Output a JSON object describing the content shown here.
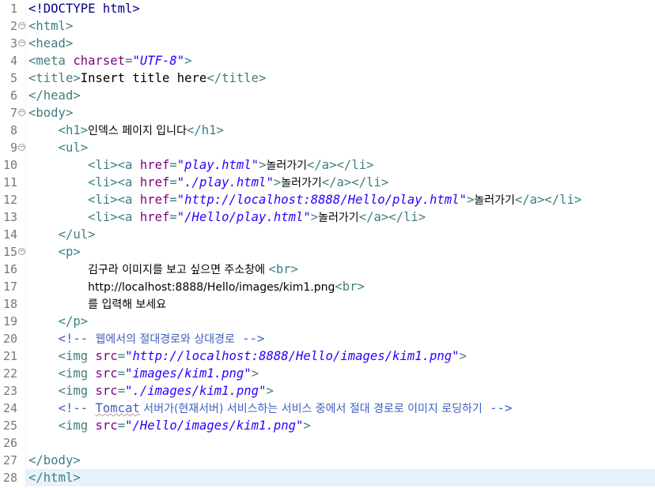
{
  "editor": {
    "current_line": 28,
    "colors": {
      "tag": "#3f7f7f",
      "attribute": "#7f007f",
      "value": "#2a00ff",
      "comment": "#3f5fbf",
      "doctype": "#000080",
      "text": "#000000",
      "current_line_bg": "#e8f2fe",
      "line_number": "#787878"
    },
    "lines": [
      {
        "no": "1",
        "fold": false,
        "tokens": [
          {
            "t": "dt",
            "v": "<!DOCTYPE html>"
          }
        ]
      },
      {
        "no": "2",
        "fold": true,
        "tokens": [
          {
            "t": "tag",
            "v": "<html>"
          }
        ]
      },
      {
        "no": "3",
        "fold": true,
        "tokens": [
          {
            "t": "tag",
            "v": "<head>"
          }
        ]
      },
      {
        "no": "4",
        "fold": false,
        "tokens": [
          {
            "t": "tag",
            "v": "<meta "
          },
          {
            "t": "attr",
            "v": "charset"
          },
          {
            "t": "tag",
            "v": "="
          },
          {
            "t": "val",
            "v": "\"UTF-8\""
          },
          {
            "t": "tag",
            "v": ">"
          }
        ]
      },
      {
        "no": "5",
        "fold": false,
        "tokens": [
          {
            "t": "tag",
            "v": "<title>"
          },
          {
            "t": "text",
            "v": "Insert title here"
          },
          {
            "t": "tag",
            "v": "</title>"
          }
        ]
      },
      {
        "no": "6",
        "fold": false,
        "tokens": [
          {
            "t": "tag",
            "v": "</head>"
          }
        ]
      },
      {
        "no": "7",
        "fold": true,
        "tokens": [
          {
            "t": "tag",
            "v": "<body>"
          }
        ]
      },
      {
        "no": "8",
        "fold": false,
        "tokens": [
          {
            "t": "sp",
            "v": "    "
          },
          {
            "t": "tag",
            "v": "<h1>"
          },
          {
            "t": "ko",
            "v": "인덱스 페이지 입니다"
          },
          {
            "t": "tag",
            "v": "</h1>"
          }
        ]
      },
      {
        "no": "9",
        "fold": true,
        "tokens": [
          {
            "t": "sp",
            "v": "    "
          },
          {
            "t": "tag",
            "v": "<ul>"
          }
        ]
      },
      {
        "no": "10",
        "fold": false,
        "tokens": [
          {
            "t": "sp",
            "v": "        "
          },
          {
            "t": "tag",
            "v": "<li><a "
          },
          {
            "t": "attr",
            "v": "href"
          },
          {
            "t": "tag",
            "v": "="
          },
          {
            "t": "val",
            "v": "\"play.html\""
          },
          {
            "t": "tag",
            "v": ">"
          },
          {
            "t": "ko",
            "v": "놀러가기"
          },
          {
            "t": "tag",
            "v": "</a></li>"
          }
        ]
      },
      {
        "no": "11",
        "fold": false,
        "tokens": [
          {
            "t": "sp",
            "v": "        "
          },
          {
            "t": "tag",
            "v": "<li><a "
          },
          {
            "t": "attr",
            "v": "href"
          },
          {
            "t": "tag",
            "v": "="
          },
          {
            "t": "val",
            "v": "\"./play.html\""
          },
          {
            "t": "tag",
            "v": ">"
          },
          {
            "t": "ko",
            "v": "놀러가기"
          },
          {
            "t": "tag",
            "v": "</a></li>"
          }
        ]
      },
      {
        "no": "12",
        "fold": false,
        "tokens": [
          {
            "t": "sp",
            "v": "        "
          },
          {
            "t": "tag",
            "v": "<li><a "
          },
          {
            "t": "attr",
            "v": "href"
          },
          {
            "t": "tag",
            "v": "="
          },
          {
            "t": "val",
            "v": "\"http://localhost:8888/Hello/play.html\""
          },
          {
            "t": "tag",
            "v": ">"
          },
          {
            "t": "ko",
            "v": "놀러가기"
          },
          {
            "t": "tag",
            "v": "</a></li>"
          }
        ]
      },
      {
        "no": "13",
        "fold": false,
        "tokens": [
          {
            "t": "sp",
            "v": "        "
          },
          {
            "t": "tag",
            "v": "<li><a "
          },
          {
            "t": "attr",
            "v": "href"
          },
          {
            "t": "tag",
            "v": "="
          },
          {
            "t": "val",
            "v": "\"/Hello/play.html\""
          },
          {
            "t": "tag",
            "v": ">"
          },
          {
            "t": "ko",
            "v": "놀러가기"
          },
          {
            "t": "tag",
            "v": "</a></li>"
          }
        ]
      },
      {
        "no": "14",
        "fold": false,
        "tokens": [
          {
            "t": "sp",
            "v": "    "
          },
          {
            "t": "tag",
            "v": "</ul>"
          }
        ]
      },
      {
        "no": "15",
        "fold": true,
        "tokens": [
          {
            "t": "sp",
            "v": "    "
          },
          {
            "t": "tag",
            "v": "<p>"
          }
        ]
      },
      {
        "no": "16",
        "fold": false,
        "tokens": [
          {
            "t": "sp",
            "v": "        "
          },
          {
            "t": "ko",
            "v": "김구라 이미지를 보고 싶으면 주소창에 "
          },
          {
            "t": "tag",
            "v": "<br>"
          }
        ]
      },
      {
        "no": "17",
        "fold": false,
        "tokens": [
          {
            "t": "sp",
            "v": "        "
          },
          {
            "t": "ko",
            "v": "http://localhost:8888/Hello/images/kim1.png"
          },
          {
            "t": "tag",
            "v": "<br>"
          }
        ]
      },
      {
        "no": "18",
        "fold": false,
        "tokens": [
          {
            "t": "sp",
            "v": "        "
          },
          {
            "t": "ko",
            "v": "를 입력해 보세요"
          }
        ]
      },
      {
        "no": "19",
        "fold": false,
        "tokens": [
          {
            "t": "sp",
            "v": "    "
          },
          {
            "t": "tag",
            "v": "</p>"
          }
        ]
      },
      {
        "no": "20",
        "fold": false,
        "tokens": [
          {
            "t": "sp",
            "v": "    "
          },
          {
            "t": "com",
            "v": "<!-- "
          },
          {
            "t": "comko",
            "v": "웹에서의 절대경로와 상대경로"
          },
          {
            "t": "com",
            "v": " -->"
          }
        ]
      },
      {
        "no": "21",
        "fold": false,
        "tokens": [
          {
            "t": "sp",
            "v": "    "
          },
          {
            "t": "tag",
            "v": "<img "
          },
          {
            "t": "attr",
            "v": "src"
          },
          {
            "t": "tag",
            "v": "="
          },
          {
            "t": "val",
            "v": "\"http://localhost:8888/Hello/images/kim1.png\""
          },
          {
            "t": "tag",
            "v": ">"
          }
        ]
      },
      {
        "no": "22",
        "fold": false,
        "tokens": [
          {
            "t": "sp",
            "v": "    "
          },
          {
            "t": "tag",
            "v": "<img "
          },
          {
            "t": "attr",
            "v": "src"
          },
          {
            "t": "tag",
            "v": "="
          },
          {
            "t": "val",
            "v": "\"images/kim1.png\""
          },
          {
            "t": "tag",
            "v": ">"
          }
        ]
      },
      {
        "no": "23",
        "fold": false,
        "tokens": [
          {
            "t": "sp",
            "v": "    "
          },
          {
            "t": "tag",
            "v": "<img "
          },
          {
            "t": "attr",
            "v": "src"
          },
          {
            "t": "tag",
            "v": "="
          },
          {
            "t": "val",
            "v": "\"./images/kim1.png\""
          },
          {
            "t": "tag",
            "v": ">"
          }
        ]
      },
      {
        "no": "24",
        "fold": false,
        "tokens": [
          {
            "t": "sp",
            "v": "    "
          },
          {
            "t": "com",
            "v": "<!-- "
          },
          {
            "t": "comsq",
            "v": "Tomcat"
          },
          {
            "t": "comko",
            "v": " 서버가(현재서버) 서비스하는 서비스 중에서 절대 경로로 이미지 로딩하기"
          },
          {
            "t": "com",
            "v": " -->"
          }
        ]
      },
      {
        "no": "25",
        "fold": false,
        "tokens": [
          {
            "t": "sp",
            "v": "    "
          },
          {
            "t": "tag",
            "v": "<img "
          },
          {
            "t": "attr",
            "v": "src"
          },
          {
            "t": "tag",
            "v": "="
          },
          {
            "t": "val",
            "v": "\"/Hello/images/kim1.png\""
          },
          {
            "t": "tag",
            "v": ">"
          }
        ]
      },
      {
        "no": "26",
        "fold": false,
        "tokens": []
      },
      {
        "no": "27",
        "fold": false,
        "tokens": [
          {
            "t": "tag",
            "v": "</body>"
          }
        ]
      },
      {
        "no": "28",
        "fold": false,
        "tokens": [
          {
            "t": "tag",
            "v": "</html>"
          }
        ]
      }
    ]
  }
}
